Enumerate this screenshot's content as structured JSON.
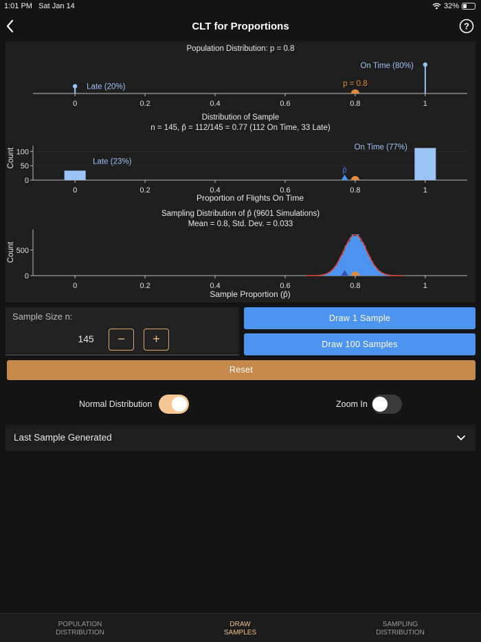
{
  "status": {
    "time": "1:01 PM",
    "date": "Sat Jan 14",
    "battery": "32%"
  },
  "nav": {
    "title": "CLT for Proportions"
  },
  "charts": {
    "population": {
      "title": "Population Distribution: p = 0.8",
      "late_label": "Late (20%)",
      "ontime_label": "On Time (80%)",
      "p_label": "p = 0.8"
    },
    "sample": {
      "title1": "Distribution of Sample",
      "title2": "n = 145, p̂ = 112/145 = 0.77 (112 On Time, 33 Late)",
      "late_label": "Late (23%)",
      "ontime_label": "On Time (77%)",
      "phat_label": "p̂",
      "ylabel": "Count",
      "xlabel": "Proportion of Flights On Time"
    },
    "sampling": {
      "title1": "Sampling Distribution of p̂ (9601 Simulations)",
      "title2": "Mean = 0.8, Std. Dev. = 0.033",
      "ylabel": "Count",
      "xlabel": "Sample Proportion (p̂)"
    },
    "x_ticks": [
      "0",
      "0.2",
      "0.4",
      "0.6",
      "0.8",
      "1"
    ],
    "sample_y_ticks": [
      "100",
      "50",
      "0"
    ],
    "sampling_y_ticks": [
      "500",
      "0"
    ]
  },
  "chart_data": [
    {
      "type": "bar",
      "title": "Population Distribution: p = 0.8",
      "x": [
        0,
        1
      ],
      "values": [
        0.2,
        0.8
      ],
      "labels": [
        "Late (20%)",
        "On Time (80%)"
      ],
      "marker": {
        "label": "p = 0.8",
        "x": 0.8
      },
      "xlim": [
        -0.12,
        1.12
      ]
    },
    {
      "type": "bar",
      "title": "Distribution of Sample",
      "subtitle": "n = 145, p̂ = 112/145 = 0.77 (112 On Time, 33 Late)",
      "x": [
        0,
        1
      ],
      "values": [
        33,
        112
      ],
      "labels": [
        "Late (23%)",
        "On Time (77%)"
      ],
      "phat": 0.77,
      "p": 0.8,
      "ylabel": "Count",
      "xlabel": "Proportion of Flights On Time",
      "ylim": [
        0,
        120
      ],
      "xlim": [
        -0.12,
        1.12
      ]
    },
    {
      "type": "area",
      "title": "Sampling Distribution of p̂ (9601 Simulations)",
      "subtitle": "Mean = 0.8, Std. Dev. = 0.033",
      "mean": 0.8,
      "sd": 0.033,
      "peak_count": 800,
      "phat": 0.77,
      "ylabel": "Count",
      "xlabel": "Sample Proportion (p̂)",
      "ylim": [
        0,
        900
      ],
      "xlim": [
        -0.12,
        1.12
      ]
    }
  ],
  "controls": {
    "sample_size_label": "Sample Size n:",
    "sample_size_value": "145",
    "minus": "−",
    "plus": "+",
    "draw1": "Draw 1 Sample",
    "draw100": "Draw 100 Samples",
    "reset": "Reset",
    "normal_label": "Normal Distribution",
    "normal_on": true,
    "zoom_label": "Zoom In",
    "zoom_on": false
  },
  "accordion": {
    "title": "Last Sample Generated"
  },
  "tabs": [
    {
      "line1": "POPULATION",
      "line2": "DISTRIBUTION"
    },
    {
      "line1": "DRAW",
      "line2": "SAMPLES"
    },
    {
      "line1": "SAMPLING",
      "line2": "DISTRIBUTION"
    }
  ],
  "colors": {
    "accent": "#f0c08a",
    "blue": "#4d94f0",
    "light_blue": "#9cc3f5",
    "orange": "#e48a3c",
    "reset": "#c5894c",
    "curve": "#e0453a"
  }
}
